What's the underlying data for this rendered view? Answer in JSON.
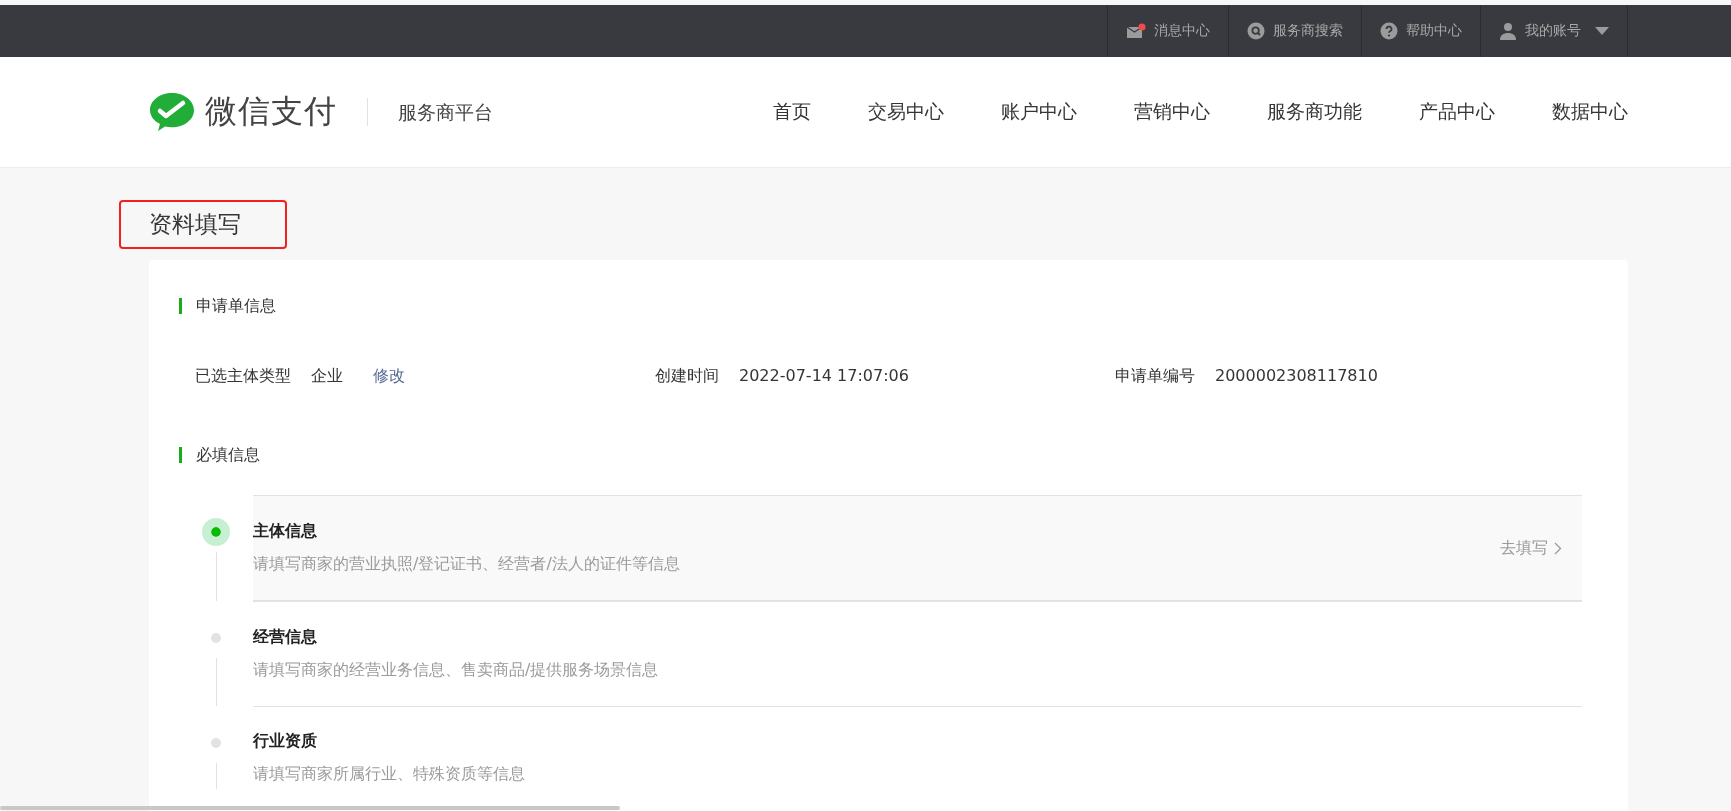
{
  "top_bar": {
    "items": [
      {
        "kind": "message",
        "label": "消息中心",
        "unread": true
      },
      {
        "kind": "search",
        "label": "服务商搜索"
      },
      {
        "kind": "help",
        "label": "帮助中心"
      },
      {
        "kind": "account",
        "label": "我的账号"
      }
    ]
  },
  "header": {
    "brand": "微信支付",
    "platform": "服务商平台",
    "nav": [
      "首页",
      "交易中心",
      "账户中心",
      "营销中心",
      "服务商功能",
      "产品中心",
      "数据中心"
    ]
  },
  "page_title": "资料填写",
  "application": {
    "section_title": "申请单信息",
    "fields": [
      {
        "label": "已选主体类型",
        "value": "企业",
        "action": "修改"
      },
      {
        "label": "创建时间",
        "value": "2022-07-14 17:07:06"
      },
      {
        "label": "申请单编号",
        "value": "2000002308117810"
      }
    ]
  },
  "required": {
    "section_title": "必填信息",
    "steps": [
      {
        "title": "主体信息",
        "description": "请填写商家的营业执照/登记证书、经营者/法人的证件等信息",
        "selected": true,
        "action": "去填写"
      },
      {
        "title": "经营信息",
        "description": "请填写商家的经营业务信息、售卖商品/提供服务场景信息",
        "selected": false
      },
      {
        "title": "行业资质",
        "description": "请填写商家所属行业、特殊资质等信息",
        "selected": false
      }
    ]
  }
}
